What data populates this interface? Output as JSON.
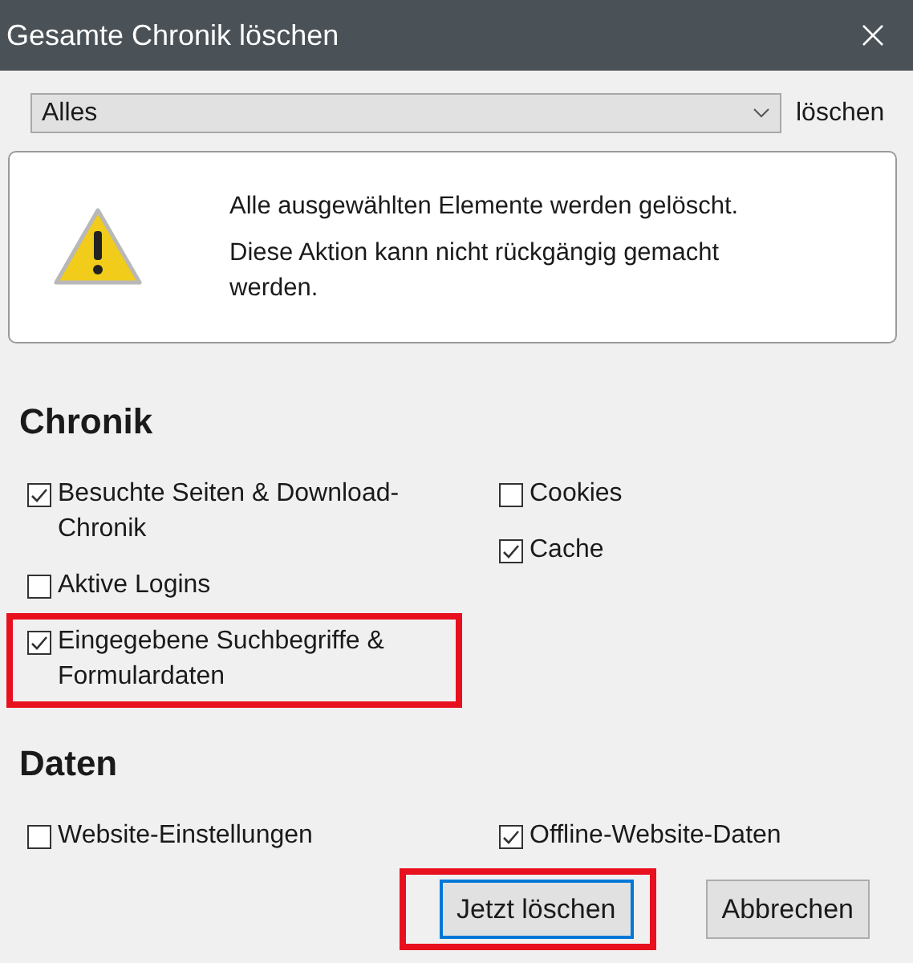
{
  "window": {
    "title": "Gesamte Chronik löschen"
  },
  "range": {
    "value": "Alles",
    "suffix": "löschen"
  },
  "warning": {
    "lines": [
      "Alle ausgewählten Elemente werden gelöscht.",
      "Diese Aktion kann nicht rückgängig gemacht werden."
    ]
  },
  "sections": [
    {
      "title": "Chronik",
      "columns": [
        [
          {
            "label": "Besuchte Seiten & Download-Chronik",
            "checked": true,
            "highlighted": false
          },
          {
            "label": "Aktive Logins",
            "checked": false,
            "highlighted": false
          },
          {
            "label": "Eingegebene Suchbegriffe & Formulardaten",
            "checked": true,
            "highlighted": true
          }
        ],
        [
          {
            "label": "Cookies",
            "checked": false,
            "highlighted": false
          },
          {
            "label": "Cache",
            "checked": true,
            "highlighted": false
          }
        ]
      ]
    },
    {
      "title": "Daten",
      "columns": [
        [
          {
            "label": "Website-Einstellungen",
            "checked": false,
            "highlighted": false
          }
        ],
        [
          {
            "label": "Offline-Website-Daten",
            "checked": true,
            "highlighted": false
          }
        ]
      ]
    }
  ],
  "buttons": [
    {
      "label": "Jetzt löschen",
      "focused": true,
      "highlighted": true
    },
    {
      "label": "Abbrechen",
      "focused": false,
      "highlighted": false
    }
  ]
}
